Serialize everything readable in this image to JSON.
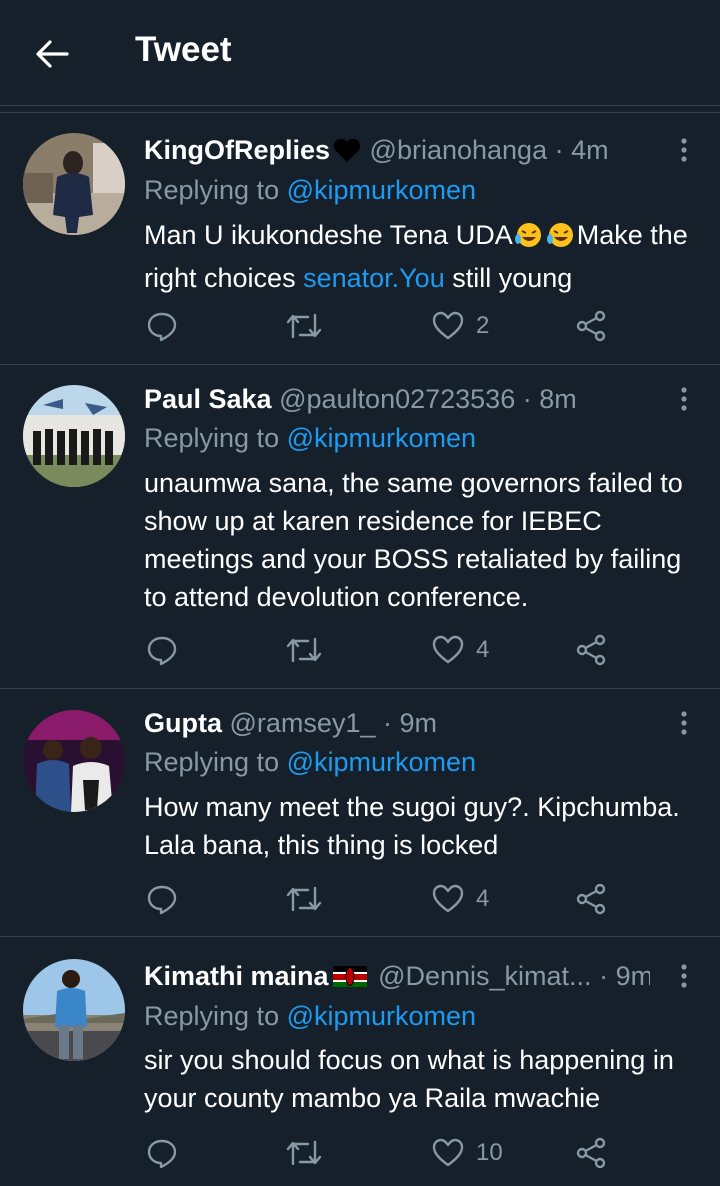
{
  "header": {
    "title": "Tweet"
  },
  "tweets": [
    {
      "name": "KingOfReplies",
      "handle": "@brianohanga",
      "dot": "·",
      "time": "4m",
      "replying_prefix": "Replying to ",
      "replying_to": "@kipmurkomen",
      "body_a": "Man U ikukondeshe Tena UDA",
      "body_b": "Make the right choices ",
      "body_link": "senator.You",
      "body_c": " still young",
      "likes": "2"
    },
    {
      "name": "Paul Saka",
      "handle": "@paulton02723536",
      "dot": "·",
      "time": "8m",
      "replying_prefix": "Replying to ",
      "replying_to": "@kipmurkomen",
      "body": "unaumwa sana, the same governors failed to show up at karen residence for IEBEC meetings and your BOSS retaliated by failing to attend devolution conference.",
      "likes": "4"
    },
    {
      "name": "Gupta",
      "handle": "@ramsey1_",
      "dot": "·",
      "time": "9m",
      "replying_prefix": "Replying to ",
      "replying_to": "@kipmurkomen",
      "body": "How many meet the sugoi guy?. Kipchumba. Lala bana, this thing is locked",
      "likes": "4"
    },
    {
      "name": "Kimathi maina",
      "handle": "@Dennis_kimat...",
      "dot": "·",
      "time": "9m",
      "replying_prefix": "Replying to ",
      "replying_to": "@kipmurkomen",
      "body": "sir you should focus on what is happening in your county mambo ya Raila mwachie",
      "likes": "10"
    }
  ],
  "icons": {
    "back": "arrow-left-icon",
    "more": "more-vertical-icon",
    "reply": "reply-icon",
    "retweet": "retweet-icon",
    "like": "heart-icon",
    "share": "share-icon"
  },
  "colors": {
    "background": "#15202b",
    "accent": "#1d9bf0",
    "secondary_text": "#8899a6",
    "divider": "#38444d"
  }
}
